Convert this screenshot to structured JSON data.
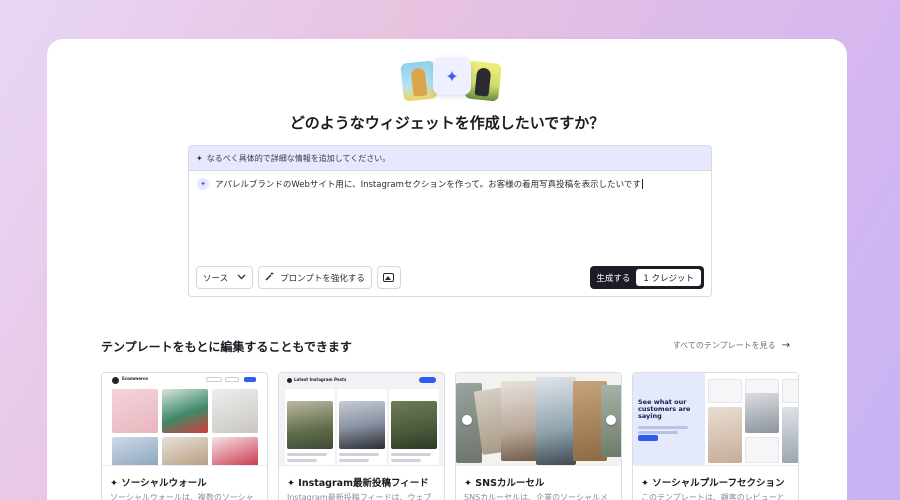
{
  "header": {
    "title": "どのようなウィジェットを作成したいですか？"
  },
  "prompt": {
    "hint": "なるべく具体的で詳細な情報を追加してください。",
    "text": "アパレルブランドのWebサイト用に、Instagramセクションを作って。お客様の着用写真投稿を表示したいです",
    "source_label": "ソース",
    "enhance_label": "プロンプトを強化する",
    "generate_label": "生成する",
    "credit_label": "1 クレジット"
  },
  "templates": {
    "section_title": "テンプレートをもとに編集することもできます",
    "view_all_label": "すべてのテンプレートを見る",
    "items": [
      {
        "name": "ソーシャルウォール",
        "desc": "ソーシャルウォールは、複数のソーシャ"
      },
      {
        "name": "Instagram最新投稿フィード",
        "desc": "Instagram最新投稿フィードは、ウェブ"
      },
      {
        "name": "SNSカルーセル",
        "desc": "SNSカルーセルは、企業のソーシャルメ"
      },
      {
        "name": "ソーシャルプルーフセクション",
        "desc": "このテンプレートは、顧客のレビューと"
      }
    ],
    "thumb_texts": {
      "brand": "Ecommerce",
      "feed_title": "Latest Instagram Posts",
      "proof_heading": "See what our customers are saying"
    }
  },
  "colors": {
    "accent": "#3b5cf5",
    "dark_button": "#1c1c26",
    "hint_bg": "#e6e8fb"
  },
  "icons": {
    "sparkle": "✦",
    "arrow": "→",
    "chevron": "⌄"
  }
}
